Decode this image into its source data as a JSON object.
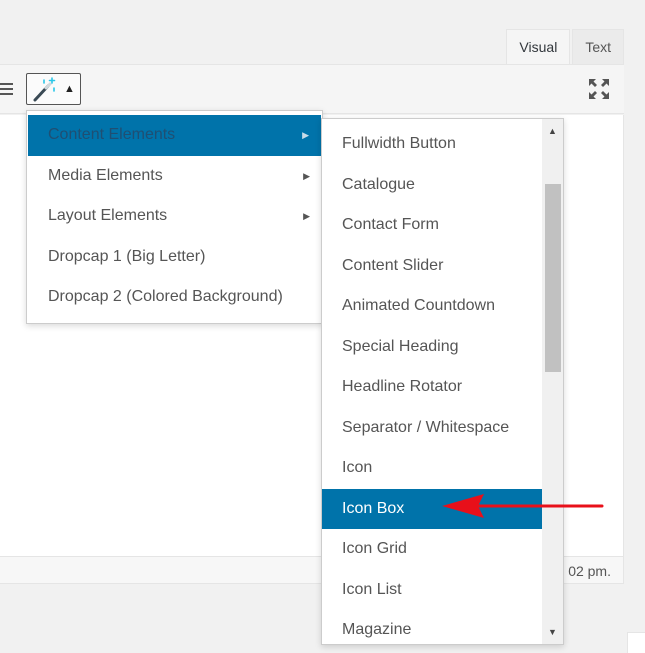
{
  "tabs": {
    "visual": "Visual",
    "text": "Text"
  },
  "toolbar": {
    "shortcode_icon": "magic-wand-icon",
    "caret": "▲",
    "fullscreen_icon": "fullscreen-icon"
  },
  "status": {
    "time_fragment": "02 pm."
  },
  "menu_primary": {
    "items": [
      {
        "label": "Content Elements",
        "has_submenu": true,
        "active": true
      },
      {
        "label": "Media Elements",
        "has_submenu": true
      },
      {
        "label": "Layout Elements",
        "has_submenu": true
      },
      {
        "label": "Dropcap 1 (Big Letter)",
        "has_submenu": false
      },
      {
        "label": "Dropcap 2 (Colored Background)",
        "has_submenu": false
      }
    ],
    "submenu_arrow": "▶"
  },
  "menu_submenu": {
    "items": [
      "Fullwidth Button",
      "Catalogue",
      "Contact Form",
      "Content Slider",
      "Animated Countdown",
      "Special Heading",
      "Headline Rotator",
      "Separator / Whitespace",
      "Icon",
      "Icon Box",
      "Icon Grid",
      "Icon List",
      "Magazine"
    ],
    "selected": "Icon Box",
    "scroll_up": "▲",
    "scroll_down": "▼"
  },
  "colors": {
    "accent": "#0073aa",
    "annotation_arrow": "#e8101a"
  }
}
